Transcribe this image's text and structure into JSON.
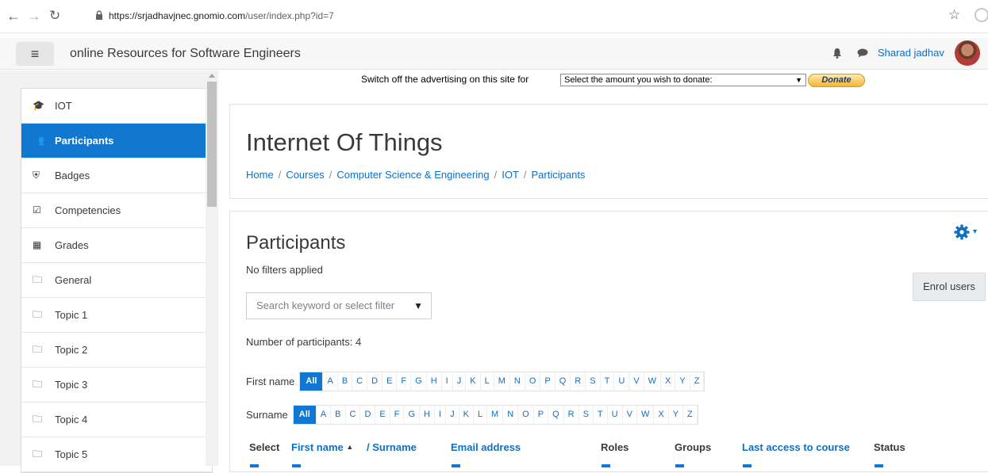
{
  "browser": {
    "url_host": "https://srjadhavjnec.gnomio.com",
    "url_path": "/user/index.php?id=7"
  },
  "navbar": {
    "menu_icon": "hamburger-icon",
    "site_name": "online Resources for Software Engineers",
    "user_name": "Sharad jadhav"
  },
  "sidebar": {
    "items": [
      {
        "label": "IOT",
        "icon": "graduation-cap-icon",
        "glyph": "🎓"
      },
      {
        "label": "Participants",
        "icon": "users-icon",
        "glyph": "👥"
      },
      {
        "label": "Badges",
        "icon": "shield-icon",
        "glyph": "⛨"
      },
      {
        "label": "Competencies",
        "icon": "check-square-icon",
        "glyph": "☑"
      },
      {
        "label": "Grades",
        "icon": "table-icon",
        "glyph": "▦"
      },
      {
        "label": "General",
        "icon": "folder-icon",
        "glyph": "🗀"
      },
      {
        "label": "Topic 1",
        "icon": "folder-icon",
        "glyph": "🗀"
      },
      {
        "label": "Topic 2",
        "icon": "folder-icon",
        "glyph": "🗀"
      },
      {
        "label": "Topic 3",
        "icon": "folder-icon",
        "glyph": "🗀"
      },
      {
        "label": "Topic 4",
        "icon": "folder-icon",
        "glyph": "🗀"
      },
      {
        "label": "Topic 5",
        "icon": "folder-icon",
        "glyph": "🗀"
      }
    ],
    "active_index": 1
  },
  "ad": {
    "text": "Switch off the advertising on this site for",
    "select_value": "Select the amount you wish to donate:",
    "donate_label": "Donate"
  },
  "header": {
    "title": "Internet Of Things",
    "breadcrumb": [
      "Home",
      "Courses",
      "Computer Science & Engineering",
      "IOT",
      "Participants"
    ]
  },
  "main": {
    "title": "Participants",
    "filters_text": "No filters applied",
    "enrol_label": "Enrol users",
    "search_placeholder": "Search keyword or select filter",
    "count_text": "Number of participants: 4",
    "first_name_label": "First name",
    "surname_label": "Surname",
    "all_label": "All",
    "letters": [
      "A",
      "B",
      "C",
      "D",
      "E",
      "F",
      "G",
      "H",
      "I",
      "J",
      "K",
      "L",
      "M",
      "N",
      "O",
      "P",
      "Q",
      "R",
      "S",
      "T",
      "U",
      "V",
      "W",
      "X",
      "Y",
      "Z"
    ],
    "columns": {
      "select": "Select",
      "first_name": "First name",
      "surname": "/ Surname",
      "email": "Email address",
      "roles": "Roles",
      "groups": "Groups",
      "last_access": "Last access to course",
      "status": "Status"
    }
  },
  "colors": {
    "accent": "#1177d1",
    "link": "#0f6fc5"
  }
}
